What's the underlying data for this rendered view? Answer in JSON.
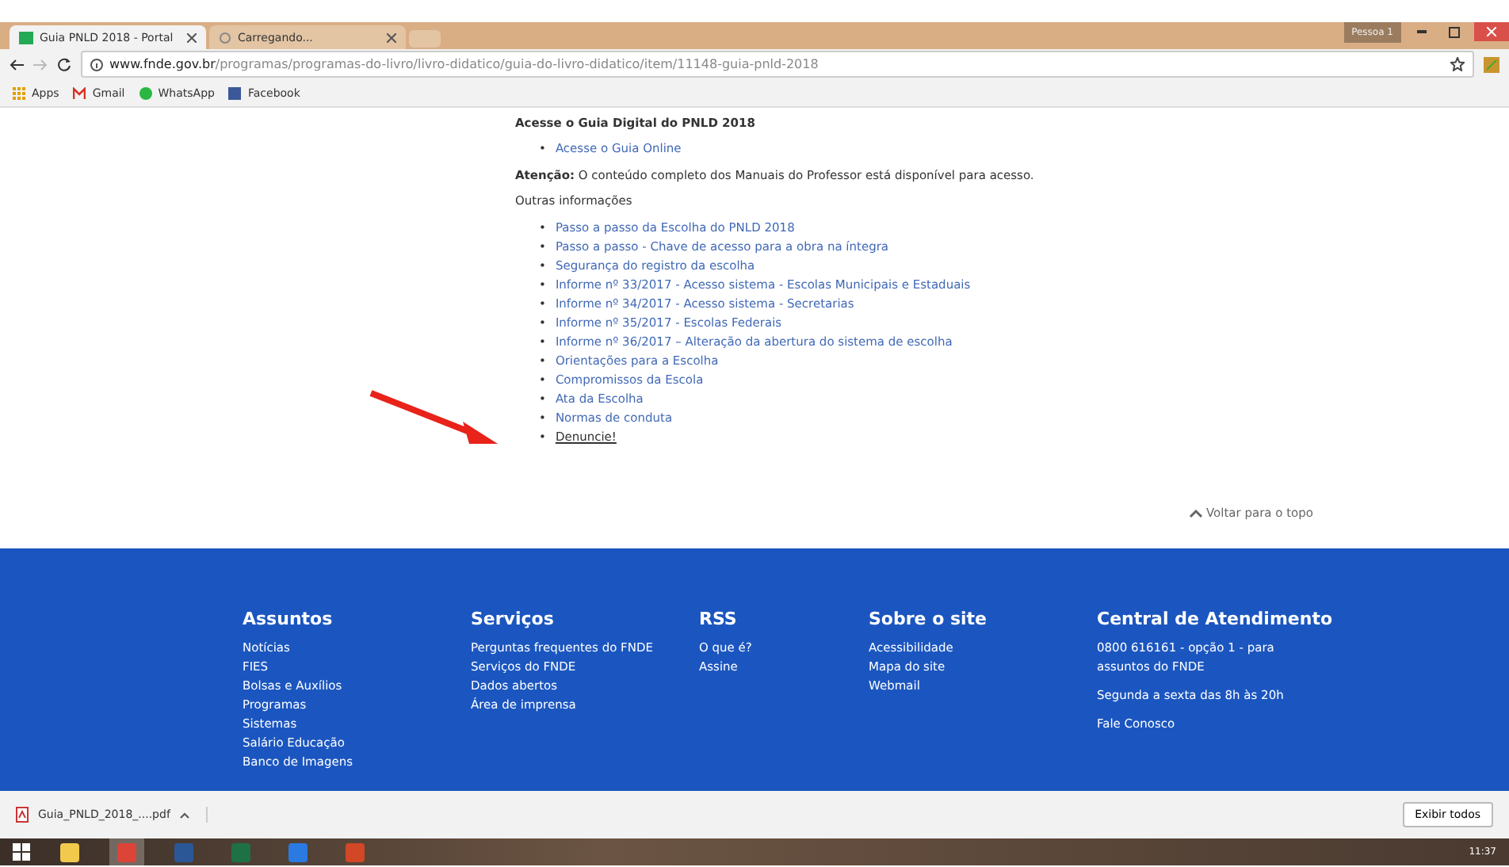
{
  "tabs": [
    {
      "title": "Guia PNLD 2018 - Portal",
      "selected": true,
      "kind": "page"
    },
    {
      "title": "Carregando...",
      "selected": false,
      "kind": "loading"
    }
  ],
  "profile": "Pessoa 1",
  "address": {
    "host": "www.fnde.gov.br",
    "path": "/programas/programas-do-livro/livro-didatico/guia-do-livro-didatico/item/11148-guia-pnld-2018"
  },
  "bookmarks": [
    {
      "label": "Apps",
      "kind": "apps"
    },
    {
      "label": "Gmail",
      "kind": "gmail"
    },
    {
      "label": "WhatsApp",
      "kind": "whatsapp"
    },
    {
      "label": "Facebook",
      "kind": "facebook"
    }
  ],
  "content": {
    "bullet": "•",
    "heading": "Acesse o Guia Digital do PNLD 2018",
    "guide_links": [
      "Acesse o Guia Online"
    ],
    "notice": "**Atenção:** O conteúdo completo dos Manuais do Professor está disponível para acesso.",
    "other_heading": "Outras informações",
    "links": [
      {
        "label": "Passo a passo da Escolha do PNLD 2018",
        "visited": false
      },
      {
        "label": "Passo a passo - Chave de acesso para a obra na íntegra",
        "visited": false
      },
      {
        "label": "Segurança do registro da escolha",
        "visited": false
      },
      {
        "label": "Informe nº 33/2017 - Acesso sistema - Escolas Municipais e Estaduais",
        "visited": false
      },
      {
        "label": "Informe nº 34/2017 - Acesso sistema - Secretarias",
        "visited": false
      },
      {
        "label": "Informe nº 35/2017 - Escolas Federais",
        "visited": false
      },
      {
        "label": "Informe nº 36/2017 – Alteração da abertura do sistema de escolha",
        "visited": false
      },
      {
        "label": "Orientações para a Escolha",
        "visited": false
      },
      {
        "label": "Compromissos da Escola",
        "visited": false
      },
      {
        "label": "Ata da Escolha",
        "visited": false
      },
      {
        "label": "Normas de conduta",
        "visited": false
      },
      {
        "label": "Denuncie!",
        "visited": true
      }
    ],
    "back_to_top": "Voltar para o topo"
  },
  "footer": [
    {
      "title": "Assuntos",
      "items": [
        "Notícias",
        "FIES",
        "Bolsas e Auxílios",
        "Programas",
        "Sistemas",
        "Salário Educação",
        "Banco de Imagens"
      ]
    },
    {
      "title": "Serviços",
      "items": [
        "Perguntas frequentes do FNDE",
        "Serviços do FNDE",
        "Dados abertos",
        "Área de imprensa"
      ]
    },
    {
      "title": "RSS",
      "items": [
        "O que é?",
        "Assine"
      ]
    },
    {
      "title": "Sobre o site",
      "items": [
        "Acessibilidade",
        "Mapa do site",
        "Webmail"
      ]
    },
    {
      "title": "Central de Atendimento",
      "paragraphs": [
        "0800 616161 - opção 1 - para assuntos do FNDE",
        "Segunda a sexta das 8h às 20h",
        "Fale Conosco"
      ]
    }
  ],
  "download": {
    "file": "Guia_PNLD_2018_....pdf",
    "show_all": "Exibir todos"
  },
  "taskbar": {
    "apps": [
      {
        "kind": "files",
        "selected": false
      },
      {
        "kind": "chrome",
        "selected": true
      },
      {
        "kind": "word",
        "selected": false
      },
      {
        "kind": "excel",
        "selected": false
      },
      {
        "kind": "reader",
        "selected": false
      },
      {
        "kind": "powerpoint",
        "selected": false
      }
    ],
    "time": "11:37"
  }
}
